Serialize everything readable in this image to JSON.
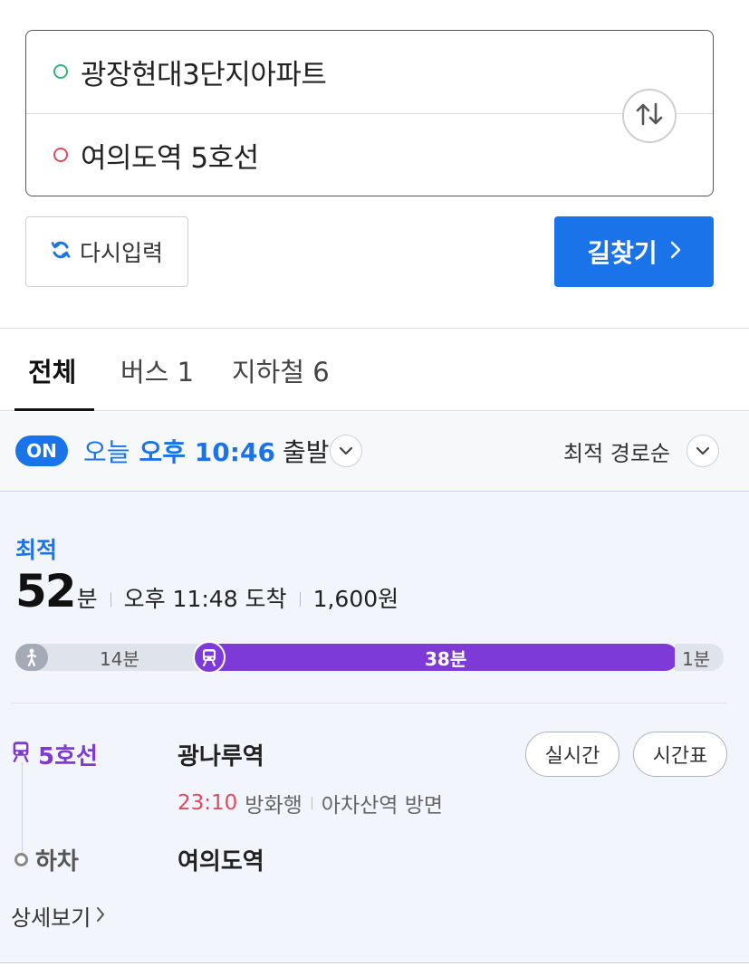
{
  "search": {
    "origin": "광장현대3단지아파트",
    "destination": "여의도역 5호선",
    "swap_icon": "swap-vertical-icon"
  },
  "actions": {
    "reset_label": "다시입력",
    "find_label": "길찾기"
  },
  "tabs": [
    {
      "label": "전체",
      "active": true
    },
    {
      "label": "버스 1",
      "active": false
    },
    {
      "label": "지하철 6",
      "active": false
    }
  ],
  "departure": {
    "toggle": "ON",
    "day": "오늘",
    "time": "오후 10:46",
    "suffix": "출발",
    "sort": "최적 경로순"
  },
  "route": {
    "badge": "최적",
    "duration_value": "52",
    "duration_unit": "분",
    "arrival": "오후 11:48 도착",
    "fare": "1,600원",
    "segments": [
      {
        "type": "walk",
        "label": "14분",
        "minutes": 14
      },
      {
        "type": "subway",
        "label": "38분",
        "minutes": 38
      },
      {
        "type": "walk",
        "label": "1분",
        "minutes": 1
      }
    ],
    "line": "5호선",
    "board_station": "광나루역",
    "realtime_label": "실시간",
    "timetable_label": "시간표",
    "next_train_time": "23:10",
    "next_train_direction": "방화행",
    "next_station": "아차산역 방면",
    "alight_label": "하차",
    "alight_station": "여의도역",
    "detail_label": "상세보기"
  },
  "colors": {
    "primary": "#1a73e8",
    "line5": "#7e3ad7",
    "origin_dot": "#34b37a",
    "destination_dot": "#e0495c",
    "train_time": "#e0495c"
  }
}
